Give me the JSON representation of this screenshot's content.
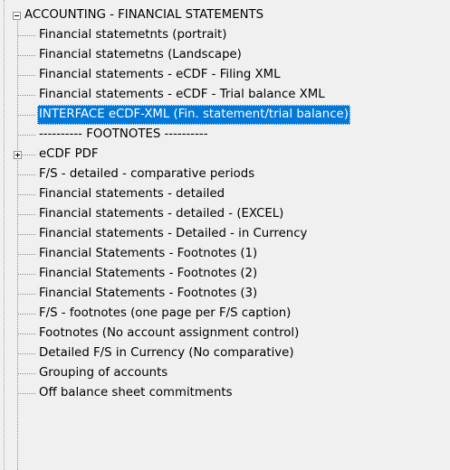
{
  "tree": {
    "root": {
      "label": "ACCOUNTING - FINANCIAL STATEMENTS",
      "expanded": true
    },
    "items": [
      {
        "label": "Financial statemetnts (portrait)",
        "selected": false,
        "has_children": false
      },
      {
        "label": "Financial statemetns (Landscape)",
        "selected": false,
        "has_children": false
      },
      {
        "label": "Financial statements - eCDF - Filing XML",
        "selected": false,
        "has_children": false
      },
      {
        "label": "Financial statements - eCDF - Trial balance XML",
        "selected": false,
        "has_children": false
      },
      {
        "label": "INTERFACE eCDF-XML (Fin. statement/trial balance)",
        "selected": true,
        "has_children": false
      },
      {
        "label": "---------- FOOTNOTES ----------",
        "selected": false,
        "has_children": false
      },
      {
        "label": "eCDF PDF",
        "selected": false,
        "has_children": true,
        "expanded": false
      },
      {
        "label": "F/S - detailed - comparative periods",
        "selected": false,
        "has_children": false
      },
      {
        "label": "Financial statements - detailed",
        "selected": false,
        "has_children": false
      },
      {
        "label": "Financial statements - detailed - (EXCEL)",
        "selected": false,
        "has_children": false
      },
      {
        "label": "Financial statements - Detailed - in Currency",
        "selected": false,
        "has_children": false
      },
      {
        "label": "Financial Statements - Footnotes  (1)",
        "selected": false,
        "has_children": false
      },
      {
        "label": "Financial Statements - Footnotes (2)",
        "selected": false,
        "has_children": false
      },
      {
        "label": "Financial Statements - Footnotes  (3)",
        "selected": false,
        "has_children": false
      },
      {
        "label": "F/S - footnotes (one page per F/S caption)",
        "selected": false,
        "has_children": false
      },
      {
        "label": "Footnotes (No account assignment control)",
        "selected": false,
        "has_children": false
      },
      {
        "label": "Detailed F/S in Currency (No comparative)",
        "selected": false,
        "has_children": false
      },
      {
        "label": "Grouping of accounts",
        "selected": false,
        "has_children": false
      },
      {
        "label": "Off balance sheet  commitments",
        "selected": false,
        "has_children": false
      }
    ]
  },
  "colors": {
    "background": "#f0f0f0",
    "selection_background": "#0078d7",
    "selection_text": "#ffffff",
    "connector_lines": "#8f8f8f"
  }
}
